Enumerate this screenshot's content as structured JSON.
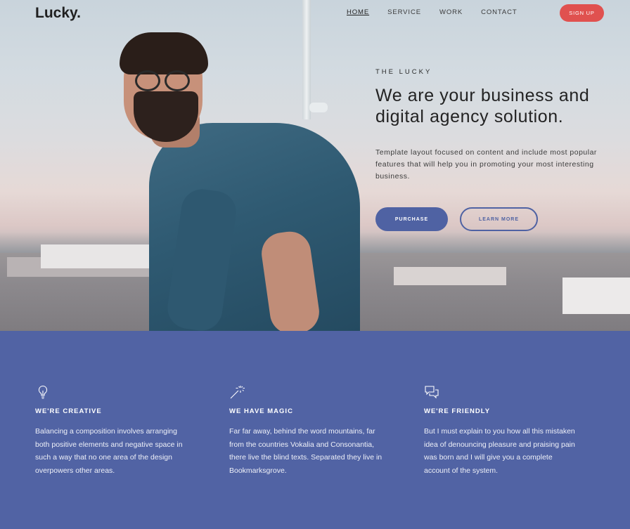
{
  "brand": {
    "logo": "Lucky."
  },
  "nav": {
    "items": [
      "HOME",
      "SERVICE",
      "WORK",
      "CONTACT"
    ],
    "active": "HOME",
    "signup_label": "SIGN UP"
  },
  "hero": {
    "eyebrow": "THE LUCKY",
    "headline": "We are your business and digital agency solution.",
    "lead": "Template layout focused on content and include most popular features that will help you in promoting your most interesting business.",
    "primary_button": "PURCHASE",
    "secondary_button": "LEARN MORE"
  },
  "features": [
    {
      "icon": "lightbulb-icon",
      "title": "WE'RE CREATIVE",
      "text": "Balancing a composition involves arranging both positive elements and negative space in such a way that no one area of the design overpowers other areas."
    },
    {
      "icon": "magic-wand-icon",
      "title": "WE HAVE MAGIC",
      "text": "Far far away, behind the word mountains, far from the countries Vokalia and Consonantia, there live the blind texts. Separated they live in Bookmarksgrove."
    },
    {
      "icon": "chat-bubbles-icon",
      "title": "WE'RE FRIENDLY",
      "text": "But I must explain to you how all this mistaken idea of denouncing pleasure and praising pain was born and I will give you a complete account of the system."
    }
  ],
  "colors": {
    "accent": "#4f62a3",
    "features_bg": "#5163a4",
    "signup": "#e0514f"
  }
}
